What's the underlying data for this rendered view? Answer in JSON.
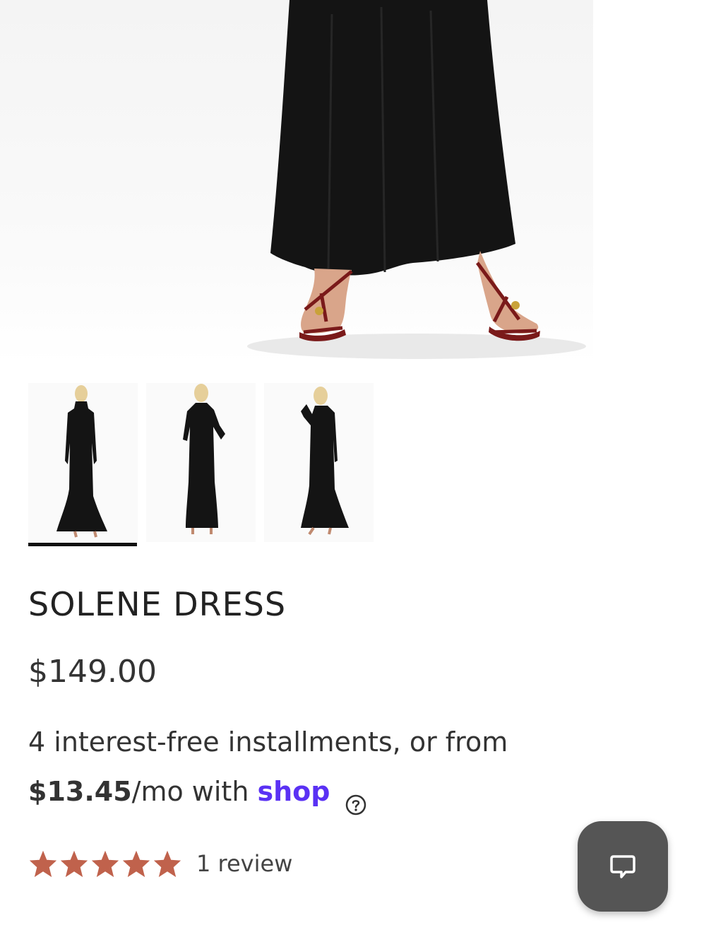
{
  "product": {
    "title": "SOLENE DRESS",
    "price": "$149.00"
  },
  "payment": {
    "installments_text": "4 interest-free installments, or from",
    "monthly_amount": "$13.45",
    "monthly_suffix": "/mo with",
    "provider_logo": "shop",
    "help_icon": "question-circle-icon"
  },
  "rating": {
    "stars": 5,
    "review_count_label": "1 review",
    "star_color": "#c0624c"
  },
  "gallery": {
    "selected_index": 0,
    "thumbnail_count": 3
  },
  "chat": {
    "icon": "chat-bubble-icon",
    "bg_color": "#555555"
  },
  "colors": {
    "shop_purple": "#5a31f4",
    "dress_black": "#141414"
  }
}
